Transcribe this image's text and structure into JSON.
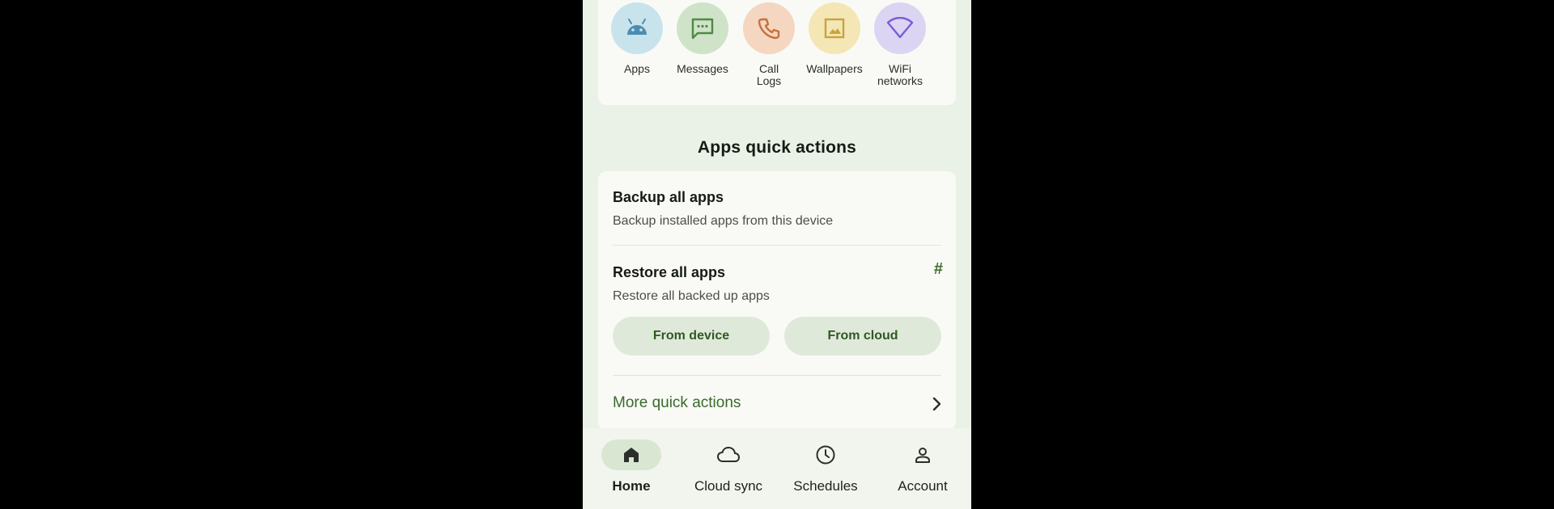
{
  "categories": [
    {
      "label": "Apps",
      "icon": "android-icon",
      "bg": "#c8e3ec",
      "fg": "#4b8db3"
    },
    {
      "label": "Messages",
      "icon": "message-icon",
      "bg": "#cfe3c9",
      "fg": "#4e8a45"
    },
    {
      "label": "Call\nLogs",
      "icon": "phone-icon",
      "bg": "#f4d6c1",
      "fg": "#c7703b"
    },
    {
      "label": "Wallpapers",
      "icon": "image-icon",
      "bg": "#f4e6b5",
      "fg": "#c9a43d"
    },
    {
      "label": "WiFi\nnetworks",
      "icon": "wifi-icon",
      "bg": "#dcd4f3",
      "fg": "#7a5cd6"
    }
  ],
  "section_title": "Apps quick actions",
  "quick_actions": {
    "backup": {
      "title": "Backup all apps",
      "subtitle": "Backup installed apps from this device"
    },
    "restore": {
      "title": "Restore all apps",
      "subtitle": "Restore all backed up apps",
      "badge": "#",
      "from_device": "From device",
      "from_cloud": "From cloud"
    },
    "more": "More quick actions"
  },
  "nav": {
    "items": [
      {
        "label": "Home",
        "icon": "home-icon",
        "active": true
      },
      {
        "label": "Cloud sync",
        "icon": "cloud-icon",
        "active": false
      },
      {
        "label": "Schedules",
        "icon": "clock-icon",
        "active": false
      },
      {
        "label": "Account",
        "icon": "account-icon",
        "active": false
      }
    ]
  },
  "colors": {
    "accent": "#3a6a2c",
    "surface": "#f9faf6",
    "background": "#eaf1e6"
  }
}
